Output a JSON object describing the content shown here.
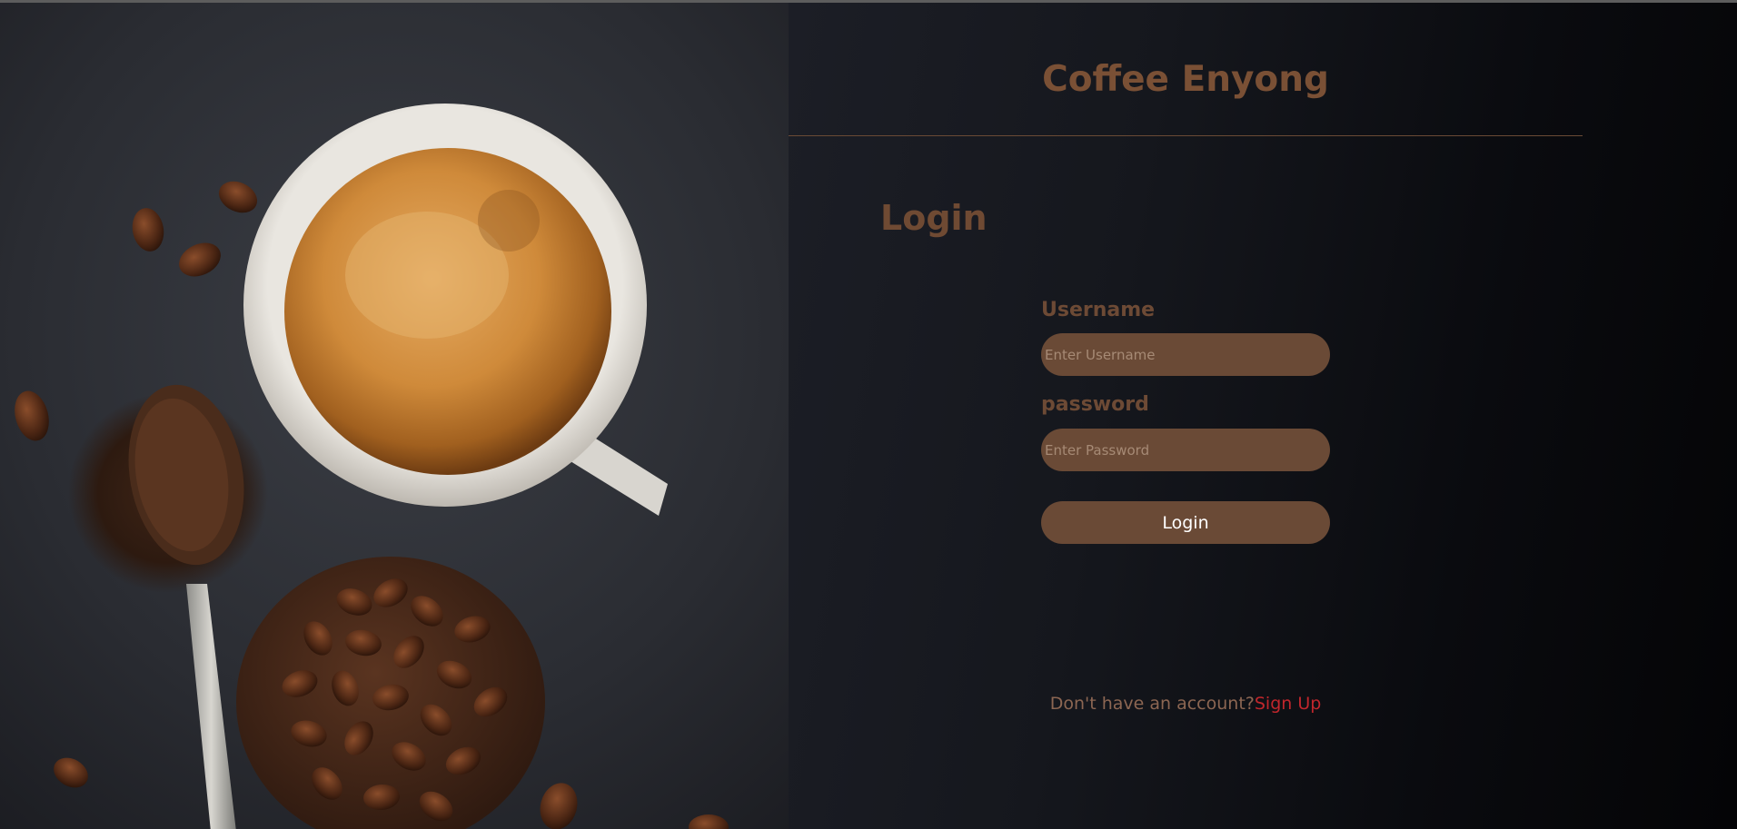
{
  "app": {
    "brand_title": "Coffee Enyong"
  },
  "hero": {
    "image_name": "coffee-cup-and-beans-photo"
  },
  "form": {
    "heading": "Login",
    "username_label": "Username",
    "username_placeholder": "Enter Username",
    "username_value": "",
    "password_label": "password",
    "password_placeholder": "Enter Password",
    "password_value": "",
    "submit_label": "Login"
  },
  "footer": {
    "prompt": "Don't have an account?",
    "signup_link": "Sign Up"
  },
  "colors": {
    "brand_brown": "#7a5035",
    "field_fill": "#6a4a36",
    "link_red": "#c0262c",
    "background_dark": "#15171d"
  }
}
